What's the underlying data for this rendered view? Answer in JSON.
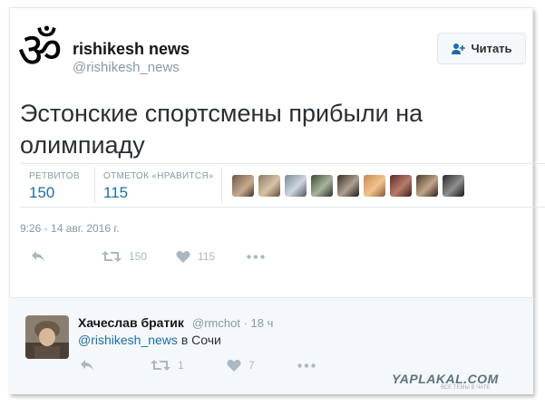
{
  "tweet": {
    "display_name": "rishikesh news",
    "handle": "@rishikesh_news",
    "follow_label": "Читать",
    "text_line1": "Эстонские спортсмены прибыли на",
    "text_line2": "олимпиаду",
    "stats": {
      "retweets_label": "РЕТВИТОВ",
      "retweets_value": "150",
      "likes_label": "ОТМЕТОК «НРАВИТСЯ»",
      "likes_value": "115"
    },
    "likers": [
      "avatar-1",
      "avatar-2",
      "avatar-3",
      "avatar-4",
      "avatar-5",
      "avatar-6",
      "avatar-7",
      "avatar-8",
      "avatar-9"
    ],
    "timestamp": "9:26 - 14 авг. 2016 г.",
    "actions": {
      "retweet_count": "150",
      "like_count": "115"
    }
  },
  "reply": {
    "display_name": "Хачеслав братик",
    "handle": "@rmchot",
    "time": "18 ч",
    "mention": "@rishikesh_news",
    "text": "в Сочи",
    "actions": {
      "retweet_count": "1",
      "like_count": "7"
    }
  },
  "watermark": {
    "text": "YAPLAKAL.COM",
    "sub": "ВСЕ ТЕМЫ В ЧАТЕ"
  },
  "colors": {
    "link": "#1c6ea4",
    "muted": "#8899a6",
    "icon": "#aab8c2",
    "border": "#e1e8ed"
  },
  "icons": [
    "om-logo",
    "follow-person-icon",
    "reply-icon",
    "retweet-icon",
    "heart-icon",
    "more-icon"
  ]
}
